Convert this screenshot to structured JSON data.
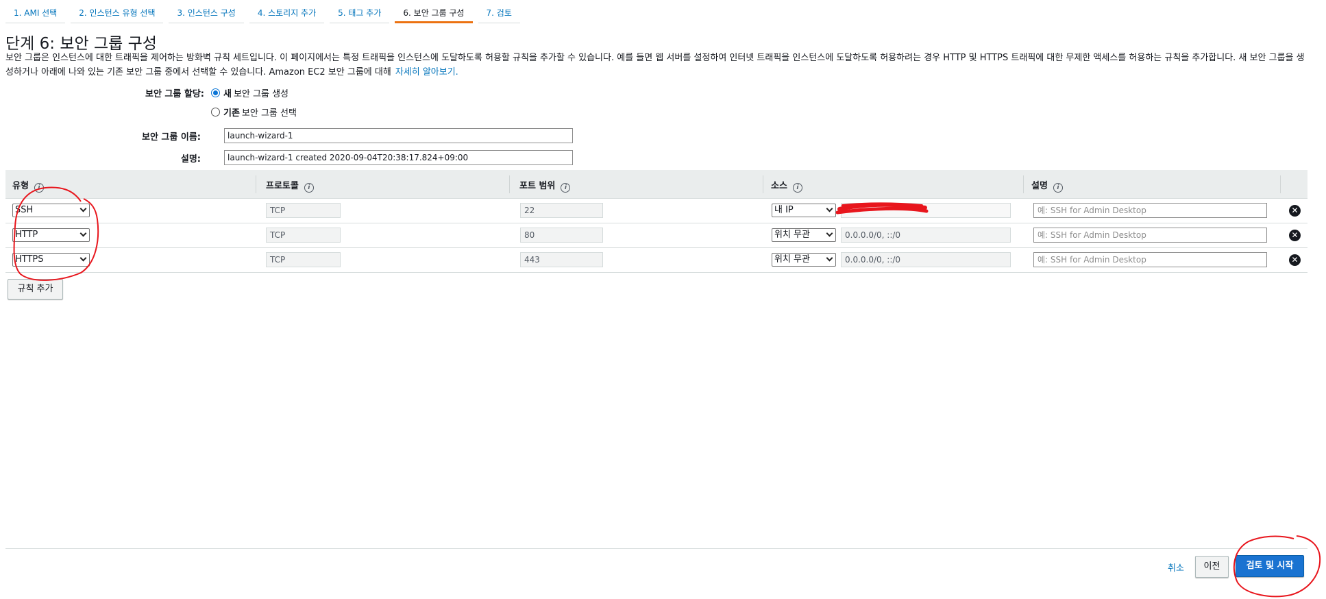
{
  "wizard": {
    "steps": [
      {
        "label": "1. AMI 선택"
      },
      {
        "label": "2. 인스턴스 유형 선택"
      },
      {
        "label": "3. 인스턴스 구성"
      },
      {
        "label": "4. 스토리지 추가"
      },
      {
        "label": "5. 태그 추가"
      },
      {
        "label": "6. 보안 그룹 구성",
        "active": true
      },
      {
        "label": "7. 검토"
      }
    ]
  },
  "header": {
    "title": "단계 6: 보안 그룹 구성",
    "description": "보안 그룹은 인스턴스에 대한 트래픽을 제어하는 방화벽 규칙 세트입니다. 이 페이지에서는 특정 트래픽을 인스턴스에 도달하도록 허용할 규칙을 추가할 수 있습니다. 예를 들면 웹 서버를 설정하여 인터넷 트래픽을 인스턴스에 도달하도록 허용하려는 경우 HTTP 및 HTTPS 트래픽에 대한 무제한 액세스를 허용하는 규칙을 추가합니다. 새 보안 그룹을 생성하거나 아래에 나와 있는 기존 보안 그룹 중에서 선택할 수 있습니다. Amazon EC2 보안 그룹에 대해",
    "learn_more": "자세히 알아보기."
  },
  "form": {
    "assign_label": "보안 그룹 할당:",
    "option_new_bold": "새",
    "option_new_rest": "보안 그룹 생성",
    "option_existing_bold": "기존",
    "option_existing_rest": "보안 그룹 선택",
    "name_label": "보안 그룹 이름:",
    "name_value": "launch-wizard-1",
    "desc_label": "설명:",
    "desc_value": "launch-wizard-1 created 2020-09-04T20:38:17.824+09:00"
  },
  "table": {
    "headers": [
      "유형",
      "프로토콜",
      "포트 범위",
      "소스",
      "설명"
    ],
    "info_glyph": "i",
    "rows": [
      {
        "type": "SSH",
        "protocol": "TCP",
        "port": "22",
        "source_type": "내 IP",
        "source_value": "",
        "description_placeholder": "예: SSH for Admin Desktop"
      },
      {
        "type": "HTTP",
        "protocol": "TCP",
        "port": "80",
        "source_type": "위치 무관",
        "source_value": "0.0.0.0/0, ::/0",
        "description_placeholder": "예: SSH for Admin Desktop"
      },
      {
        "type": "HTTPS",
        "protocol": "TCP",
        "port": "443",
        "source_type": "위치 무관",
        "source_value": "0.0.0.0/0, ::/0",
        "description_placeholder": "예: SSH for Admin Desktop"
      }
    ],
    "delete_glyph": "✕",
    "add_rule_label": "규칙 추가"
  },
  "footer": {
    "cancel": "취소",
    "previous": "이전",
    "review_launch": "검토 및 시작"
  },
  "colors": {
    "accent": "#ec7211",
    "link": "#0073bb",
    "primary_button": "#1a73d1",
    "annotation": "#e8161d"
  }
}
